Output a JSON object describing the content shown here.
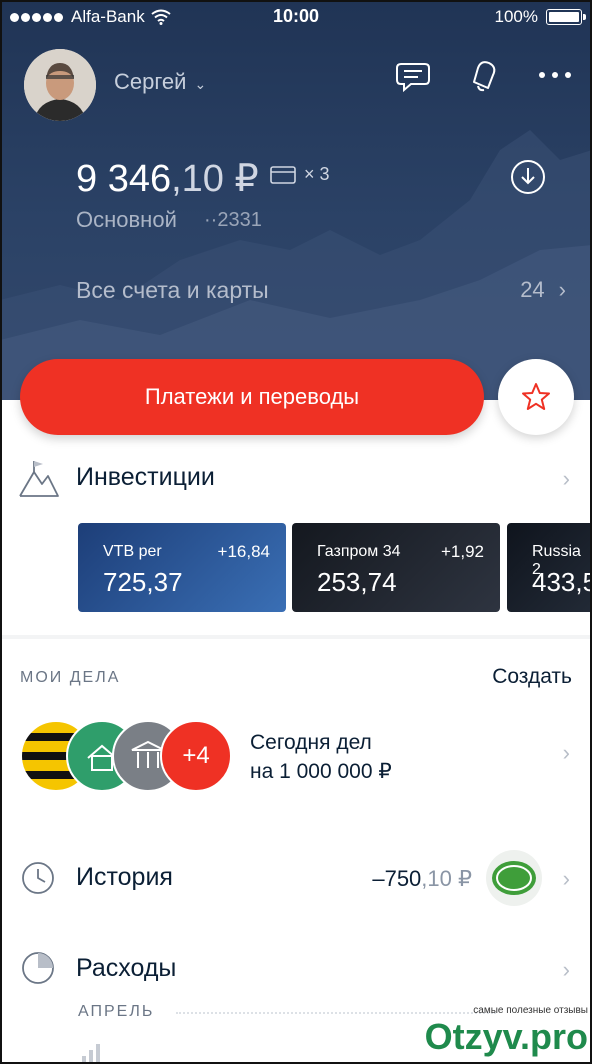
{
  "status_bar": {
    "carrier": "Alfa-Bank",
    "time": "10:00",
    "battery": "100%"
  },
  "header": {
    "username": "Сергей"
  },
  "account": {
    "balance_main": "9 346",
    "balance_fraction": ",10 ₽",
    "cards_count": "× 3",
    "name": "Основной",
    "number": "··2331"
  },
  "all_accounts": {
    "label": "Все счета и карты",
    "count": "24"
  },
  "payments_button": "Платежи и переводы",
  "investments": {
    "title": "Инвестиции",
    "cards": [
      {
        "name": "VTB per",
        "change": "+16,84",
        "price": "725,37"
      },
      {
        "name": "Газпром 34",
        "change": "+1,92",
        "price": "253,74"
      },
      {
        "name": "Russia 2",
        "change": "",
        "price": "433,5"
      }
    ]
  },
  "deals": {
    "section_label": "МОИ ДЕЛА",
    "create_label": "Создать",
    "more_count": "+4",
    "line1": "Сегодня дел",
    "line2": "на 1 000 000 ₽"
  },
  "history": {
    "title": "История",
    "amount_main": "–750",
    "amount_fraction": ",10 ₽"
  },
  "expenses": {
    "title": "Расходы",
    "month": "АПРЕЛЬ"
  },
  "watermark": {
    "small": "самые полезные отзывы",
    "big": "Otzyv.pro"
  },
  "colors": {
    "accent": "#ef3124",
    "hero": "#2b4266"
  }
}
